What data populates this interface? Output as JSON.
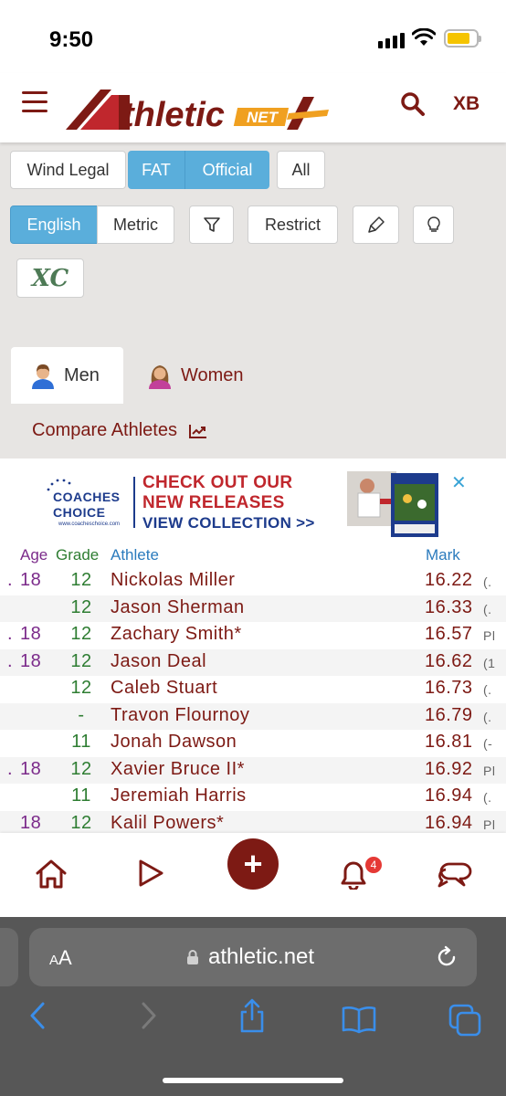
{
  "status_bar": {
    "time": "9:50"
  },
  "header": {
    "logo_main": "thletic",
    "logo_net": "NET",
    "user_initials": "XB"
  },
  "filters": {
    "wind_legal": "Wind Legal",
    "fat": "FAT",
    "official": "Official",
    "all": "All",
    "english": "English",
    "metric": "Metric",
    "restrict": "Restrict",
    "xc": "XC"
  },
  "gender_tabs": {
    "men": "Men",
    "women": "Women"
  },
  "compare_label": "Compare Athletes",
  "ad": {
    "brand_line1": "COACHES",
    "brand_line2": "CHOICE",
    "brand_url": "www.coacheschoice.com",
    "headline1": "CHECK OUT OUR",
    "headline2": "NEW RELEASES",
    "cta": "VIEW COLLECTION >>",
    "close": "✕"
  },
  "table": {
    "headers": {
      "age": "Age",
      "grade": "Grade",
      "athlete": "Athlete",
      "mark": "Mark"
    },
    "rows": [
      {
        "dot": ".",
        "age": "18",
        "grade": "12",
        "athlete": "Nickolas Miller",
        "mark": "16.22",
        "extra": "(."
      },
      {
        "dot": "",
        "age": "",
        "grade": "12",
        "athlete": "Jason Sherman",
        "mark": "16.33",
        "extra": "(."
      },
      {
        "dot": ".",
        "age": "18",
        "grade": "12",
        "athlete": "Zachary Smith*",
        "mark": "16.57",
        "extra": "Pl"
      },
      {
        "dot": ".",
        "age": "18",
        "grade": "12",
        "athlete": "Jason Deal",
        "mark": "16.62",
        "extra": "(1"
      },
      {
        "dot": "",
        "age": "",
        "grade": "12",
        "athlete": "Caleb Stuart",
        "mark": "16.73",
        "extra": "(."
      },
      {
        "dot": "",
        "age": "",
        "grade": "-",
        "athlete": "Travon Flournoy",
        "mark": "16.79",
        "extra": "(."
      },
      {
        "dot": "",
        "age": "",
        "grade": "11",
        "athlete": "Jonah Dawson",
        "mark": "16.81",
        "extra": "(-"
      },
      {
        "dot": ".",
        "age": "18",
        "grade": "12",
        "athlete": "Xavier Bruce II*",
        "mark": "16.92",
        "extra": "Pl"
      },
      {
        "dot": "",
        "age": "",
        "grade": "11",
        "athlete": "Jeremiah Harris",
        "mark": "16.94",
        "extra": "(."
      },
      {
        "dot": "",
        "age": "18",
        "grade": "12",
        "athlete": "Kalil Powers*",
        "mark": "16.94",
        "extra": "Pl"
      }
    ]
  },
  "app_bar": {
    "notification_count": "4"
  },
  "browser": {
    "text_size_label_small": "A",
    "text_size_label_large": "A",
    "url": "athletic.net"
  },
  "colors": {
    "brand": "#7d1a14",
    "accent_blue": "#5aaedb",
    "age_purple": "#7b2a8a",
    "grade_green": "#2e7d32"
  }
}
